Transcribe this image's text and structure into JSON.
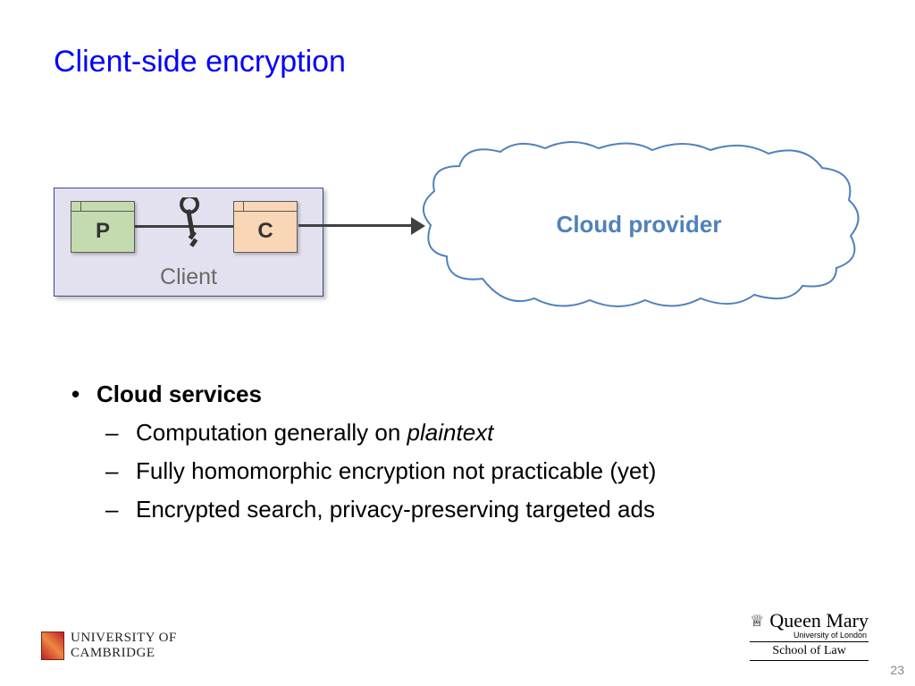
{
  "title": "Client-side encryption",
  "diagram": {
    "client_label": "Client",
    "p_label": "P",
    "c_label": "C",
    "cloud_label": "Cloud provider"
  },
  "bullets": {
    "heading": "Cloud services",
    "item1_pre": "Computation generally on ",
    "item1_em": "plaintext",
    "item2": "Fully homomorphic encryption not practicable (yet)",
    "item3": "Encrypted search, privacy-preserving targeted ads"
  },
  "footer": {
    "cambridge_line1": "UNIVERSITY OF",
    "cambridge_line2": "CAMBRIDGE",
    "qm_name": "Queen Mary",
    "qm_sub": "University of London",
    "qm_school": "School of Law"
  },
  "page_number": "23"
}
